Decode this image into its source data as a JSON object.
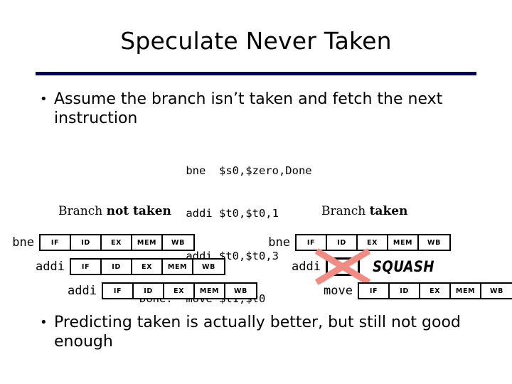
{
  "slide": {
    "title": "Speculate Never Taken",
    "rule_color": "#000066",
    "bullet_glyph": "•"
  },
  "bullets": {
    "top": "Assume the branch isn’t taken and fetch the next instruction",
    "bottom": "Predicting taken is actually better, but still not good enough"
  },
  "code": {
    "lines": [
      "       bne  $s0,$zero,Done",
      "       addi $t0,$t0,1",
      "       addi $t0,$t0,3",
      "Done:  move $t1,$t0"
    ]
  },
  "captions": {
    "left_prefix": "Branch ",
    "left_bold": "not taken",
    "right_prefix": "Branch ",
    "right_bold": "taken"
  },
  "stage_names": [
    "IF",
    "ID",
    "EX",
    "MEM",
    "WB"
  ],
  "diagrams": {
    "not_taken": {
      "rows": [
        {
          "label": "bne",
          "stages": [
            "IF",
            "ID",
            "EX",
            "MEM",
            "WB"
          ]
        },
        {
          "label": "addi",
          "stages": [
            "IF",
            "ID",
            "EX",
            "MEM",
            "WB"
          ]
        },
        {
          "label": "addi",
          "stages": [
            "IF",
            "ID",
            "EX",
            "MEM",
            "WB"
          ]
        }
      ]
    },
    "taken": {
      "rows": [
        {
          "label": "bne",
          "stages": [
            "IF",
            "ID",
            "EX",
            "MEM",
            "WB"
          ]
        },
        {
          "label": "addi",
          "stages": [
            "IF"
          ],
          "squashed": true,
          "squash_label": "SQUASH",
          "squash_color": "#f08c84"
        },
        {
          "label": "move",
          "stages": [
            "IF",
            "ID",
            "EX",
            "MEM",
            "WB"
          ]
        }
      ]
    }
  }
}
